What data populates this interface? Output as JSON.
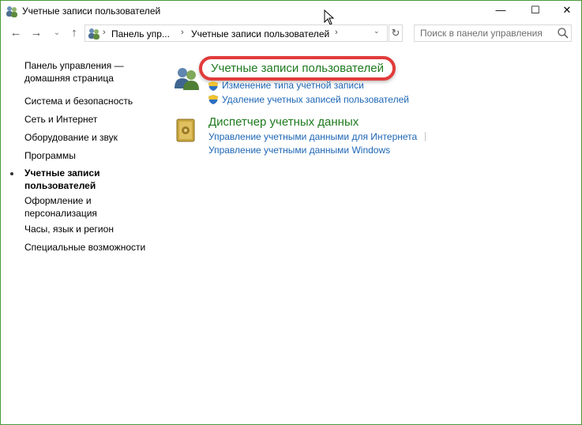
{
  "window": {
    "title": "Учетные записи пользователей",
    "controls": {
      "minimize": "—",
      "maximize": "☐",
      "close": "✕"
    }
  },
  "nav": {
    "back": "←",
    "forward": "→",
    "recent": "⌄",
    "up": "↑",
    "breadcrumb": [
      "Панель упр...",
      "Учетные записи пользователей"
    ],
    "separator": "›",
    "dropdown": "⌄",
    "refresh": "↻"
  },
  "search": {
    "placeholder": "Поиск в панели управления"
  },
  "sidebar": {
    "items": [
      {
        "label": "Панель управления —\nдомашняя страница"
      },
      {
        "label": "Система и безопасность"
      },
      {
        "label": "Сеть и Интернет"
      },
      {
        "label": "Оборудование и звук"
      },
      {
        "label": "Программы"
      },
      {
        "label": "Учетные записи\nпользователей",
        "current": true
      },
      {
        "label": "Оформление и\nперсонализация"
      },
      {
        "label": "Часы, язык и регион"
      },
      {
        "label": "Специальные возможности"
      }
    ]
  },
  "main": {
    "categories": [
      {
        "title": "Учетные записи пользователей",
        "icon": "users-icon",
        "links": [
          "Изменение типа учетной записи",
          "Удаление учетных записей пользователей"
        ]
      },
      {
        "title": "Диспетчер учетных данных",
        "icon": "credential-vault-icon",
        "links": [
          "Управление учетными данными для Интернета",
          "Управление учетными данными Windows"
        ]
      }
    ]
  },
  "colors": {
    "accent_green": "#1e7a1e",
    "link_blue": "#1d66b5",
    "highlight_red": "#e23b3b",
    "window_border": "#4a9a3a"
  }
}
